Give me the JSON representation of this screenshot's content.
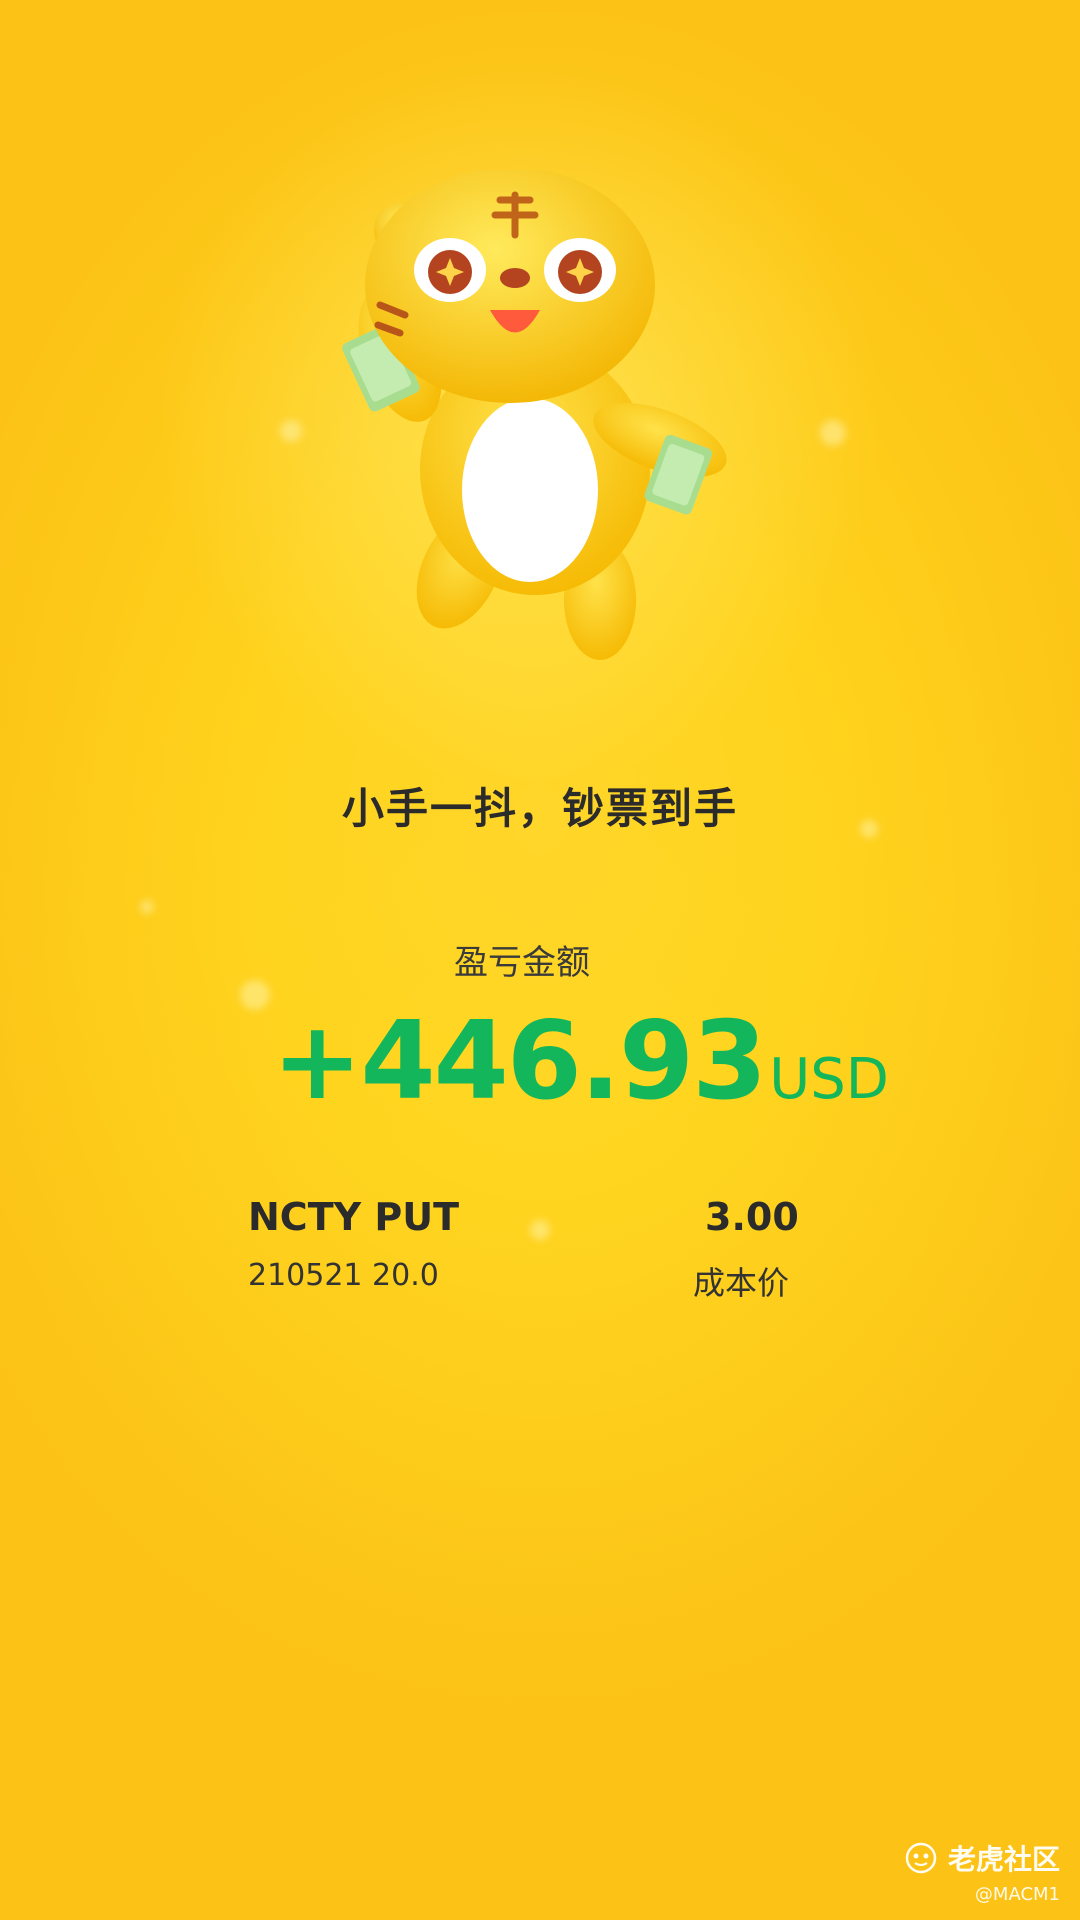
{
  "headline": "小手一抖，钞票到手",
  "pnl": {
    "label": "盈亏金额",
    "value": "+446.93",
    "currency": "USD",
    "color": "#13b65a"
  },
  "position": {
    "contract_name": "NCTY PUT",
    "contract_detail": "210521 20.0",
    "cost_value": "3.00",
    "cost_label": "成本价"
  },
  "watermark": {
    "brand": "老虎社区",
    "user": "@MACM1"
  },
  "colors": {
    "background": "#ffd21c",
    "mascot_body": "#ffcf17",
    "mascot_belly": "#ffffff",
    "cash": "#9fd98a"
  },
  "icons": {
    "mascot": "tiger-mascot-icon",
    "watermark_logo": "tiger-logo-icon"
  }
}
